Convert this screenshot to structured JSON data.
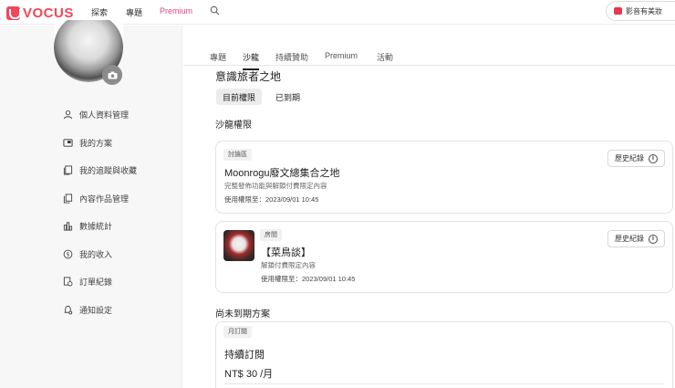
{
  "topnav": {
    "logo_text": "VOCUS",
    "links": {
      "explore": "探索",
      "topics": "專題",
      "premium": "Premium"
    },
    "promo_text": "影音有美妝"
  },
  "sidebar": {
    "items": [
      {
        "label": "個人資料管理",
        "icon": "user-icon"
      },
      {
        "label": "我的方案",
        "icon": "plan-card-icon"
      },
      {
        "label": "我的追蹤與收藏",
        "icon": "bookmark-collection-icon"
      },
      {
        "label": "內容作品管理",
        "icon": "content-files-icon"
      },
      {
        "label": "數據統計",
        "icon": "bar-chart-icon"
      },
      {
        "label": "我的收入",
        "icon": "dollar-coin-icon"
      },
      {
        "label": "訂單紀錄",
        "icon": "order-receipt-icon"
      },
      {
        "label": "通知設定",
        "icon": "bell-settings-icon"
      }
    ]
  },
  "main": {
    "tabs": [
      "專題",
      "沙龍",
      "持續贊助",
      "Premium",
      "活動"
    ],
    "active_tab": "沙龍",
    "page_title": "意識旅者之地",
    "filters": {
      "current": "目前權限",
      "expired": "已到期"
    },
    "salon_section_title": "沙龍權限",
    "cards": [
      {
        "badge": "討論區",
        "name": "Moonrogu廢文總集合之地",
        "desc": "完整發佈功能與解鎖付費限定內容",
        "date": "使用權限至：2023/09/01 10:45",
        "history_label": "歷史紀錄"
      },
      {
        "badge": "房間",
        "name": "【菜鳥談】",
        "desc": "解鎖付費限定內容",
        "date": "使用權限至：2023/09/01 10:45",
        "history_label": "歷史紀錄"
      }
    ],
    "upcoming_section_title": "尚未到期方案",
    "subscription": {
      "badge": "月訂閱",
      "name": "持續訂閱",
      "price": "NT$ 30 /月"
    }
  },
  "colors": {
    "brand": "#f0475a",
    "premium": "#e0488f",
    "sidebar_bg": "#f7f7f7"
  }
}
